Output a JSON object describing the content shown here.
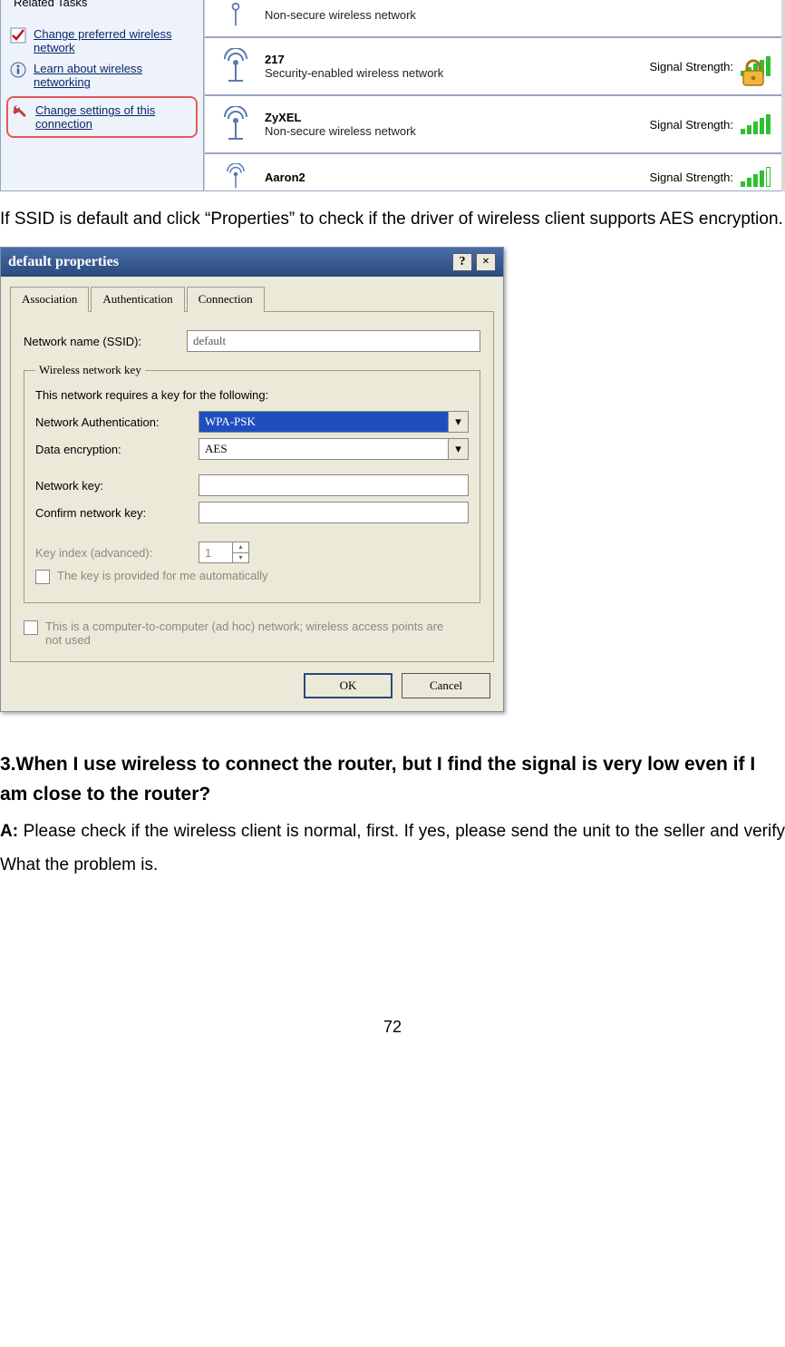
{
  "relatedTasks": {
    "header": "Related Tasks",
    "items": [
      {
        "label": "Change preferred wireless network"
      },
      {
        "label": "Learn about wireless networking"
      },
      {
        "label": "Change settings of this connection"
      }
    ]
  },
  "networks": [
    {
      "desc": "Non-secure wireless network",
      "sig": ""
    },
    {
      "name": "217",
      "desc": "Security-enabled wireless network",
      "sig": "Signal Strength:",
      "secure": true,
      "bars": 5
    },
    {
      "name": "ZyXEL",
      "desc": "Non-secure wireless network",
      "sig": "Signal Strength:",
      "bars": 5
    },
    {
      "name": "Aaron2",
      "desc": "",
      "sig": "Signal Strength:",
      "bars": 4
    }
  ],
  "paragraph1": "If SSID is default and click “Properties” to check if the driver of wireless client supports AES encryption.",
  "dialog": {
    "title": "default properties",
    "tabs": [
      "Association",
      "Authentication",
      "Connection"
    ],
    "ssidLabel": "Network name (SSID):",
    "ssidValue": "default",
    "wkLegend": "Wireless network key",
    "wkIntro": "This network requires a key for the following:",
    "authLabel": "Network Authentication:",
    "authValue": "WPA-PSK",
    "encLabel": "Data encryption:",
    "encValue": "AES",
    "keyLabel": "Network key:",
    "confirmLabel": "Confirm network key:",
    "indexLabel": "Key index (advanced):",
    "indexValue": "1",
    "autoKey": "The key is provided for me automatically",
    "adhoc": "This is a computer-to-computer (ad hoc) network; wireless access points are not used",
    "ok": "OK",
    "cancel": "Cancel"
  },
  "qa": {
    "question": "3.When I use wireless to connect the router, but I find the signal is very low even if I am close to the router?",
    "answerLabel": "A:",
    "answer": " Please check if the wireless client is normal, first. If yes, please send the unit to the seller and verify What the problem is."
  },
  "pageNumber": "72"
}
